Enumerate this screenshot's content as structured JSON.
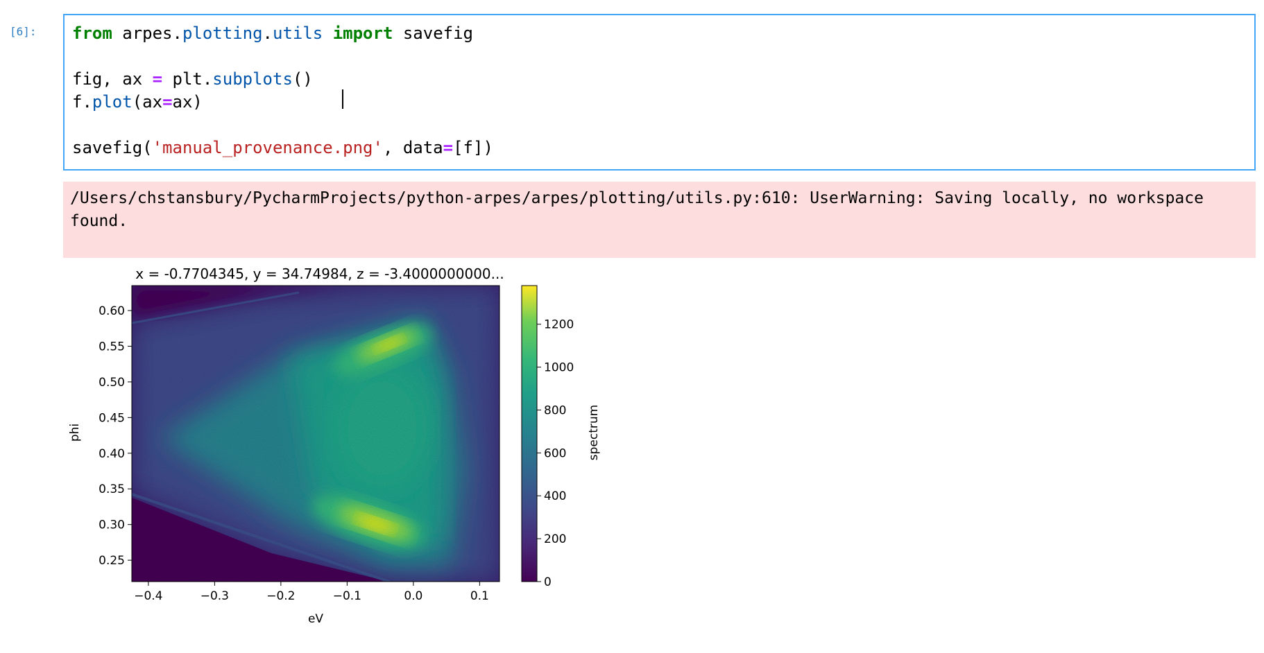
{
  "cell": {
    "prompt": "[6]:",
    "code": {
      "line1": {
        "kw_from": "from",
        "module_base": " arpes",
        "dot1": ".",
        "mod_plotting": "plotting",
        "dot2": ".",
        "mod_utils": "utils",
        "sp1": " ",
        "kw_import": "import",
        "name": " savefig"
      },
      "line3": {
        "part1": "fig, ax ",
        "eq": "=",
        "part2": " plt",
        "dot": ".",
        "func": "subplots",
        "part3": "()"
      },
      "line4": {
        "part1": "f",
        "dot": ".",
        "func": "plot",
        "part2": "(ax",
        "eq": "=",
        "part3": "ax)"
      },
      "line6": {
        "part1": "savefig(",
        "str": "'manual_provenance.png'",
        "part2": ", data",
        "eq": "=",
        "part3": "[f])"
      }
    }
  },
  "stderr": {
    "text": "/Users/chstansbury/PycharmProjects/python-arpes/arpes/plotting/utils.py:610: UserWarning: Saving locally, no workspace found."
  },
  "chart_data": {
    "type": "heatmap",
    "title": "x = -0.7704345, y = 34.74984, z = -3.4000000000...",
    "xlabel": "eV",
    "ylabel": "phi",
    "xlim": [
      -0.425,
      0.13
    ],
    "ylim": [
      0.22,
      0.635
    ],
    "x_ticks": [
      -0.4,
      -0.3,
      -0.2,
      -0.1,
      0.0,
      0.1
    ],
    "x_tick_labels": [
      "−0.4",
      "−0.3",
      "−0.2",
      "−0.1",
      "0.0",
      "0.1"
    ],
    "y_ticks": [
      0.25,
      0.3,
      0.35,
      0.4,
      0.45,
      0.5,
      0.55,
      0.6
    ],
    "y_tick_labels": [
      "0.25",
      "0.30",
      "0.35",
      "0.40",
      "0.45",
      "0.50",
      "0.55",
      "0.60"
    ],
    "colorbar": {
      "label": "spectrum",
      "range": [
        0,
        1380
      ],
      "ticks": [
        0,
        200,
        400,
        600,
        800,
        1000,
        1200
      ],
      "tick_labels": [
        "0",
        "200",
        "400",
        "600",
        "800",
        "1000",
        "1200"
      ],
      "colormap": "viridis"
    },
    "grid": false
  },
  "colors": {
    "prompt": "#307fc1",
    "cell_border": "#42a5f5",
    "stderr_bg": "#fddddd",
    "keyword": "#008000",
    "operator": "#aa22ff",
    "string": "#ba2121",
    "attribute": "#0055aa"
  }
}
